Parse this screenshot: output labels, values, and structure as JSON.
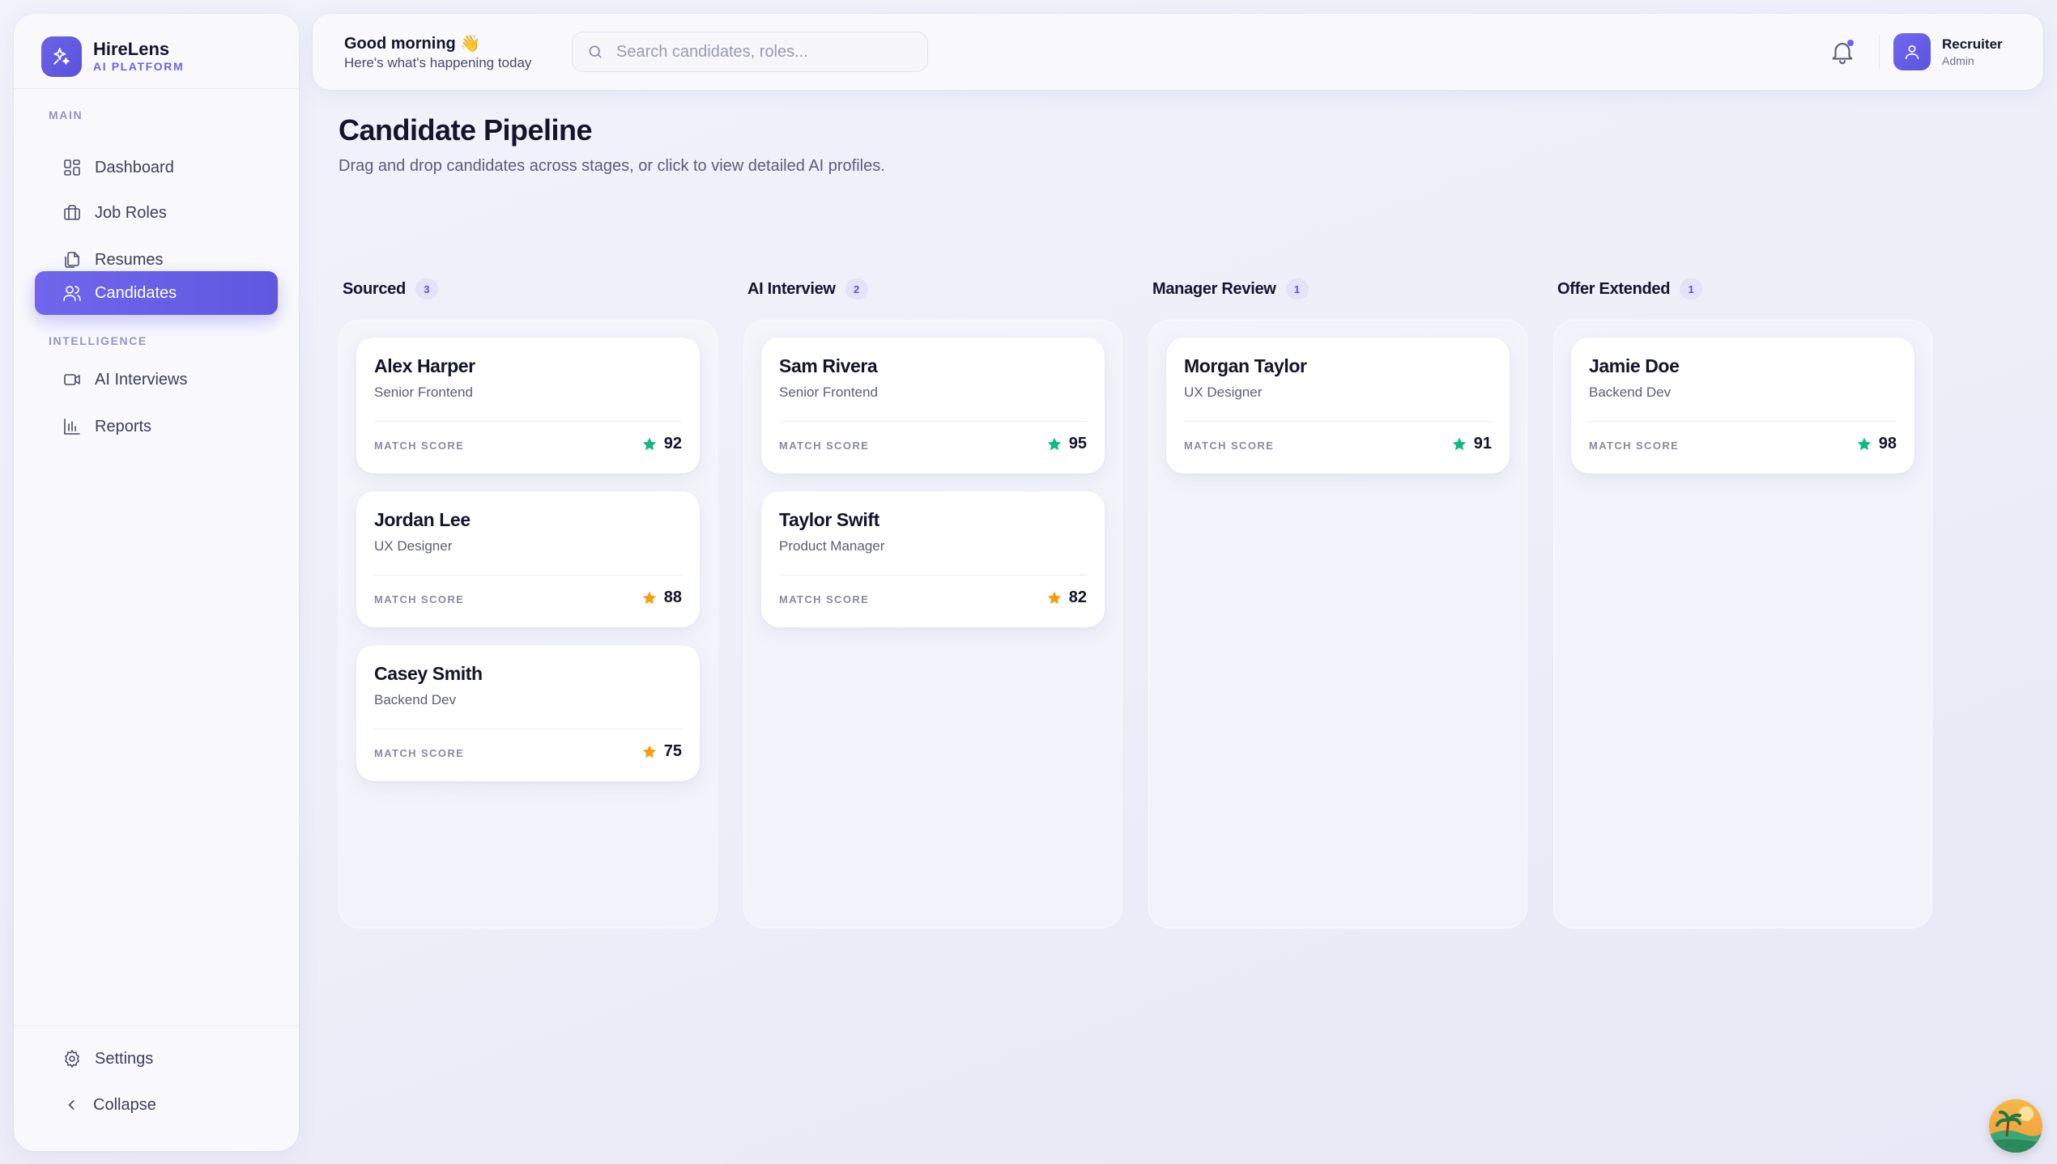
{
  "brand": {
    "name": "HireLens",
    "subtitle": "AI PLATFORM"
  },
  "sidebar": {
    "sections": {
      "main": "MAIN",
      "intelligence": "INTELLIGENCE"
    },
    "items": [
      {
        "label": "Dashboard",
        "icon": "grid-icon"
      },
      {
        "label": "Job Roles",
        "icon": "briefcase-icon"
      },
      {
        "label": "Resumes",
        "icon": "files-icon"
      },
      {
        "label": "Candidates",
        "icon": "users-icon",
        "active": true
      },
      {
        "label": "AI Interviews",
        "icon": "video-icon"
      },
      {
        "label": "Reports",
        "icon": "bar-chart-icon"
      }
    ],
    "settings_label": "Settings",
    "collapse_label": "Collapse"
  },
  "header": {
    "greeting": "Good morning 👋",
    "greeting_sub": "Here's what's happening today",
    "search_placeholder": "Search candidates, roles...",
    "user_name": "Recruiter",
    "user_role": "Admin"
  },
  "page": {
    "title": "Candidate Pipeline",
    "subtitle": "Drag and drop candidates across stages, or click to view detailed AI profiles."
  },
  "colors": {
    "accent": "#6b63e8",
    "score_high": "#10b981",
    "score_mid": "#f59e0b"
  },
  "board": {
    "match_score_label": "MATCH SCORE",
    "columns": [
      {
        "title": "Sourced",
        "count": "3",
        "cards": [
          {
            "name": "Alex Harper",
            "role": "Senior Frontend",
            "score": "92",
            "tier": "high"
          },
          {
            "name": "Jordan Lee",
            "role": "UX Designer",
            "score": "88",
            "tier": "mid"
          },
          {
            "name": "Casey Smith",
            "role": "Backend Dev",
            "score": "75",
            "tier": "mid"
          }
        ]
      },
      {
        "title": "AI Interview",
        "count": "2",
        "cards": [
          {
            "name": "Sam Rivera",
            "role": "Senior Frontend",
            "score": "95",
            "tier": "high"
          },
          {
            "name": "Taylor Swift",
            "role": "Product Manager",
            "score": "82",
            "tier": "mid"
          }
        ]
      },
      {
        "title": "Manager Review",
        "count": "1",
        "cards": [
          {
            "name": "Morgan Taylor",
            "role": "UX Designer",
            "score": "91",
            "tier": "high"
          }
        ]
      },
      {
        "title": "Offer Extended",
        "count": "1",
        "cards": [
          {
            "name": "Jamie Doe",
            "role": "Backend Dev",
            "score": "98",
            "tier": "high"
          }
        ]
      }
    ]
  }
}
